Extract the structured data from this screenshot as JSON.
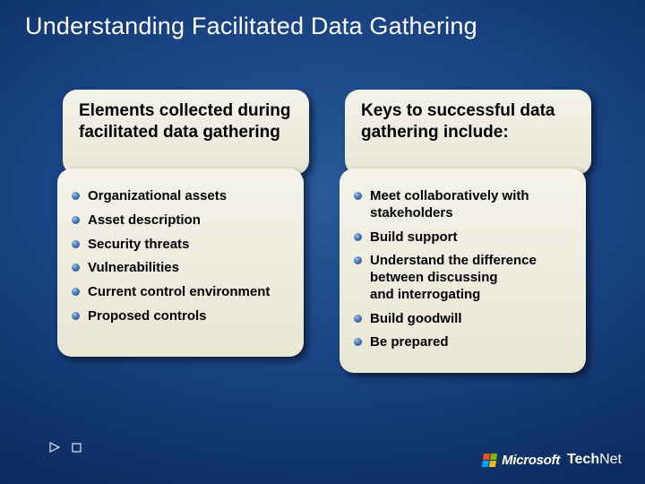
{
  "title": "Understanding Facilitated Data Gathering",
  "left": {
    "heading": "Elements collected during facilitated data gathering",
    "items": [
      "Organizational assets",
      "Asset description",
      "Security threats",
      "Vulnerabilities",
      "Current control environment",
      "Proposed controls"
    ]
  },
  "right": {
    "heading": "Keys to successful data gathering include:",
    "items": [
      "Meet collaboratively with stakeholders",
      "Build support",
      "Understand the difference between discussing and interrogating",
      "Build goodwill",
      "Be prepared"
    ]
  },
  "footer": {
    "brand_ms": "Microsoft",
    "brand_tech": "Tech",
    "brand_net": "Net"
  }
}
